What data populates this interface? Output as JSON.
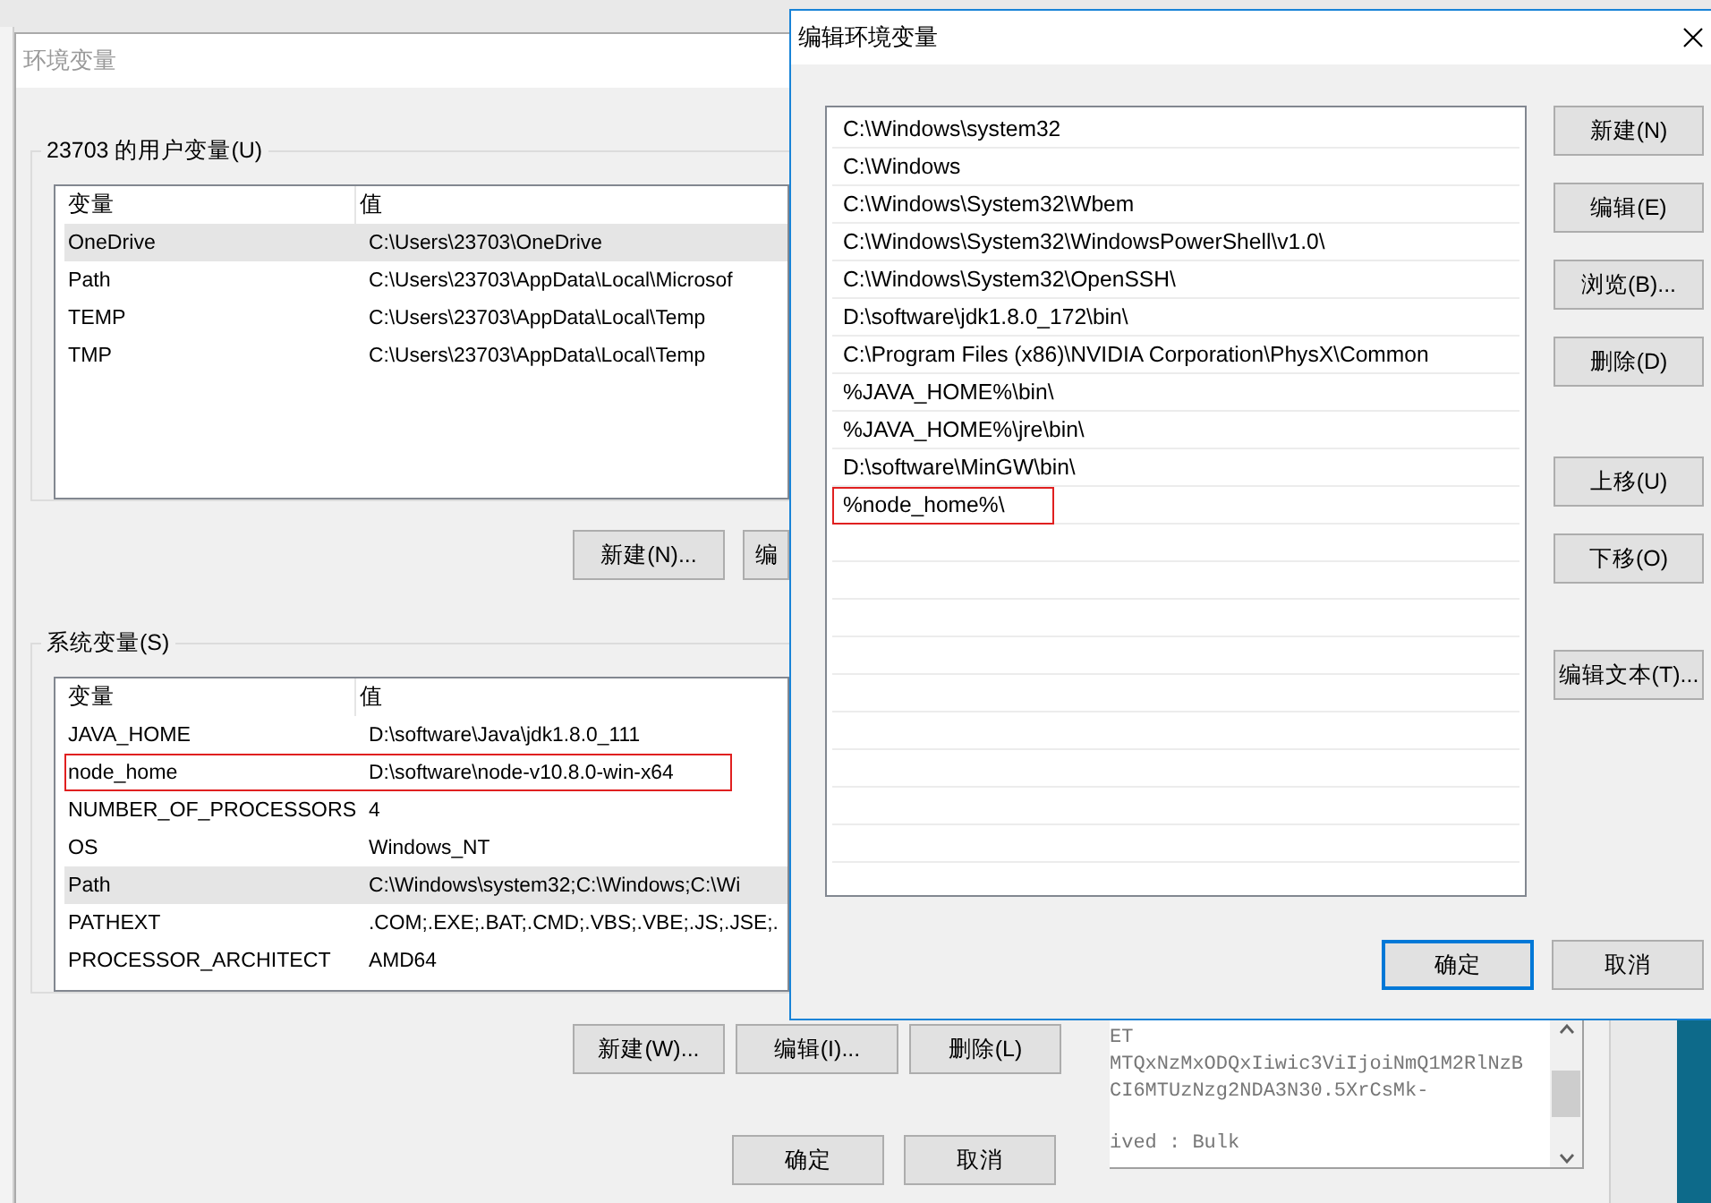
{
  "env_window": {
    "title": "环境变量",
    "user_group": {
      "label": "23703 的用户变量(U)",
      "columns": [
        "变量",
        "值"
      ],
      "rows": [
        {
          "name": "OneDrive",
          "value": "C:\\Users\\23703\\OneDrive",
          "highlighted": true,
          "marked": false
        },
        {
          "name": "Path",
          "value": "C:\\Users\\23703\\AppData\\Local\\Microsof",
          "highlighted": false,
          "marked": false
        },
        {
          "name": "TEMP",
          "value": "C:\\Users\\23703\\AppData\\Local\\Temp",
          "highlighted": false,
          "marked": false
        },
        {
          "name": "TMP",
          "value": "C:\\Users\\23703\\AppData\\Local\\Temp",
          "highlighted": false,
          "marked": false
        }
      ],
      "buttons": [
        "新建(N)...",
        "编"
      ]
    },
    "system_group": {
      "label": "系统变量(S)",
      "columns": [
        "变量",
        "值"
      ],
      "rows": [
        {
          "name": "JAVA_HOME",
          "value": "D:\\software\\Java\\jdk1.8.0_111",
          "highlighted": false,
          "marked": false
        },
        {
          "name": "node_home",
          "value": "D:\\software\\node-v10.8.0-win-x64",
          "highlighted": false,
          "marked": true
        },
        {
          "name": "NUMBER_OF_PROCESSORS",
          "value": "4",
          "highlighted": false,
          "marked": false
        },
        {
          "name": "OS",
          "value": "Windows_NT",
          "highlighted": false,
          "marked": false
        },
        {
          "name": "Path",
          "value": "C:\\Windows\\system32;C:\\Windows;C:\\Wi",
          "highlighted": true,
          "marked": false
        },
        {
          "name": "PATHEXT",
          "value": ".COM;.EXE;.BAT;.CMD;.VBS;.VBE;.JS;.JSE;.",
          "highlighted": false,
          "marked": false
        },
        {
          "name": "PROCESSOR_ARCHITECT",
          "value": "AMD64",
          "highlighted": false,
          "marked": false
        }
      ],
      "buttons": [
        "新建(W)...",
        "编辑(I)...",
        "删除(L)"
      ]
    },
    "footer_buttons": [
      {
        "label": "确定",
        "default": false
      },
      {
        "label": "取消",
        "default": false
      }
    ]
  },
  "edit_dialog": {
    "title": "编辑环境变量",
    "entries": [
      {
        "text": "C:\\Windows\\system32",
        "marked": false
      },
      {
        "text": "C:\\Windows",
        "marked": false
      },
      {
        "text": "C:\\Windows\\System32\\Wbem",
        "marked": false
      },
      {
        "text": "C:\\Windows\\System32\\WindowsPowerShell\\v1.0\\",
        "marked": false
      },
      {
        "text": "C:\\Windows\\System32\\OpenSSH\\",
        "marked": false
      },
      {
        "text": "D:\\software\\jdk1.8.0_172\\bin\\",
        "marked": false
      },
      {
        "text": "C:\\Program Files (x86)\\NVIDIA Corporation\\PhysX\\Common",
        "marked": false
      },
      {
        "text": "%JAVA_HOME%\\bin\\",
        "marked": false
      },
      {
        "text": "%JAVA_HOME%\\jre\\bin\\",
        "marked": false
      },
      {
        "text": "D:\\software\\MinGW\\bin\\",
        "marked": false
      },
      {
        "text": "%node_home%\\",
        "marked": true
      }
    ],
    "side_button_groups": [
      [
        "新建(N)",
        "编辑(E)",
        "浏览(B)...",
        "删除(D)"
      ],
      [
        "上移(U)",
        "下移(O)"
      ],
      [
        "编辑文本(T)..."
      ]
    ],
    "footer_buttons": [
      {
        "label": "确定",
        "default": true
      },
      {
        "label": "取消",
        "default": false
      }
    ]
  },
  "console_window": {
    "lines": [
      "ET",
      "MTQxNzMxODQxIiwic3ViIjoiNmQ1M2RlNzB",
      "CI6MTUzNzg2NDA3N30.5XrCsMk-",
      "ived : Bulk"
    ]
  }
}
